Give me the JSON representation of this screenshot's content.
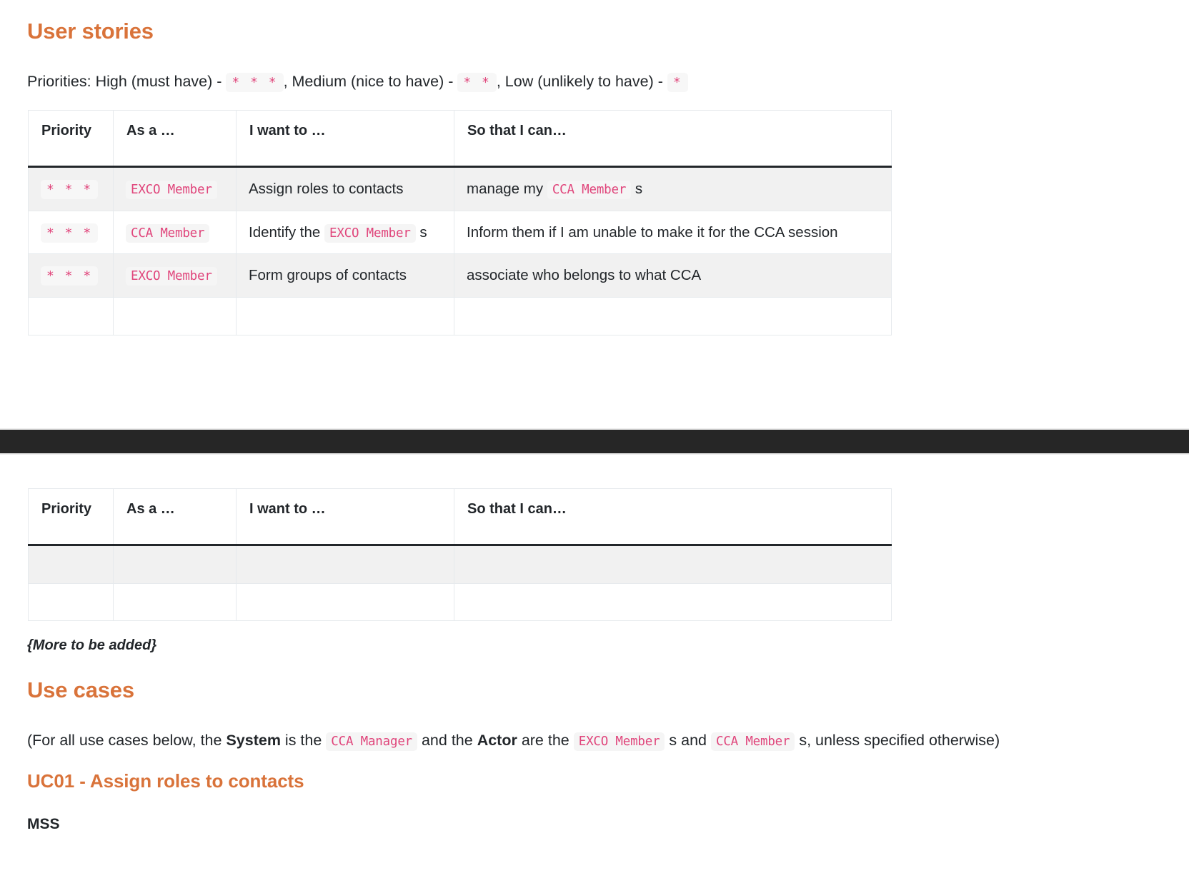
{
  "sections": {
    "user_stories": {
      "heading": "User stories",
      "priorities_intro": {
        "prefix": "Priorities: High (must have) - ",
        "high_stars": "* * *",
        "mid_text": ", Medium (nice to have) - ",
        "medium_stars": "* *",
        "low_text": ", Low (unlikely to have) - ",
        "low_stars": "*"
      },
      "table_headers": [
        "Priority",
        "As a …",
        "I want to …",
        "So that I can…"
      ],
      "rows": [
        {
          "priority": "* * *",
          "as_a_chip": "EXCO Member",
          "i_want_to": "Assign roles to contacts",
          "so_that_pre": "manage my ",
          "so_that_chip": "CCA Member",
          "so_that_post": " s"
        },
        {
          "priority": "* * *",
          "as_a_chip": "CCA Member",
          "i_want_pre": "Identify the ",
          "i_want_chip": "EXCO Member",
          "i_want_post": " s",
          "so_that": "Inform them if I am unable to make it for the CCA session"
        },
        {
          "priority": "* * *",
          "as_a_chip": "EXCO Member",
          "i_want_to": "Form groups of contacts",
          "so_that": "associate who belongs to what CCA"
        }
      ],
      "empty_row_count": 1
    },
    "continued_table": {
      "table_headers": [
        "Priority",
        "As a …",
        "I want to …",
        "So that I can…"
      ],
      "empty_row_count": 2
    },
    "more_note": "{More to be added}",
    "use_cases": {
      "heading": "Use cases",
      "intro": {
        "p1": "(For all use cases below, the ",
        "b1": "System",
        "p2": " is the ",
        "chip1": "CCA Manager",
        "p3": " and the ",
        "b2": "Actor",
        "p4": " are the ",
        "chip2": "EXCO Member",
        "p5": " s and ",
        "chip3": "CCA Member",
        "p6": " s, unless specified otherwise)"
      },
      "uc01_heading": "UC01 - Assign roles to contacts",
      "mss_heading": "MSS"
    }
  },
  "colors": {
    "heading_orange": "#d9733a",
    "chip_pink": "#e0457b",
    "chip_bg": "#f5f5f5",
    "row_shade": "#f1f1f1",
    "band_dark": "#262626",
    "border": "#e6eaed",
    "header_rule": "#22262a"
  }
}
